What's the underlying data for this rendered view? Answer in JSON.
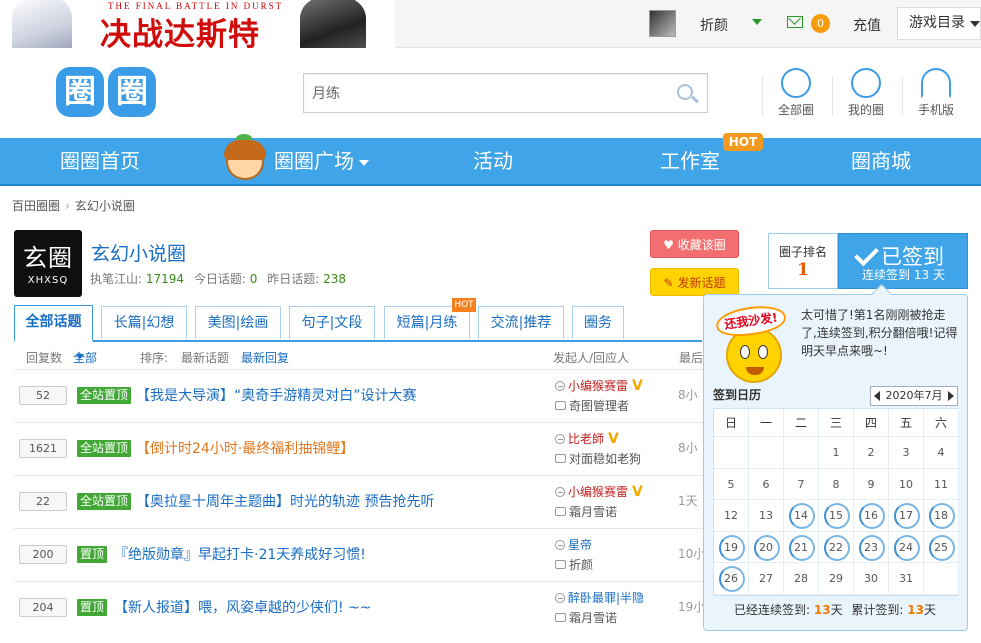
{
  "banner": {
    "subtitle": "THE FINAL BATTLE IN DURST",
    "title": "决战达斯特"
  },
  "topbar": {
    "username": "折颜",
    "mail_count": "0",
    "recharge": "充值",
    "games_menu": "游戏目录"
  },
  "header": {
    "logo": [
      "圈",
      "圈"
    ],
    "search_placeholder": "月练",
    "buttons": [
      {
        "label": "全部圈",
        "icon": "circle-refresh-icon"
      },
      {
        "label": "我的圈",
        "icon": "person-icon"
      },
      {
        "label": "手机版",
        "icon": "wifi-icon"
      }
    ]
  },
  "nav": {
    "items": [
      "圈圈首页",
      "圈圈广场",
      "活动",
      "工作室",
      "圈商城"
    ],
    "hot_tag": "HOT"
  },
  "breadcrumb": {
    "home": "百田圈圈",
    "current": "玄幻小说圈"
  },
  "group": {
    "icon_big": "玄圈",
    "icon_small": "XHXSQ",
    "name": "玄幻小说圈",
    "owner_label": "执笔江山:",
    "owner_value": "17194",
    "today_label": "今日话题:",
    "today_value": "0",
    "yesterday_label": "昨日话题:",
    "yesterday_value": "238",
    "fav_button": "收藏该圈",
    "post_button": "发新话题"
  },
  "rank": {
    "label": "圈子排名",
    "value": "1"
  },
  "signed": {
    "title": "已签到",
    "streak_label": "连续签到",
    "streak_value": "13",
    "streak_unit": "天"
  },
  "tabs": {
    "items": [
      "全部话题",
      "长篇|幻想",
      "美图|绘画",
      "句子|文段",
      "短篇|月练",
      "交流|推荐",
      "圈务"
    ],
    "hot": "HOT"
  },
  "filters": {
    "replies": "回复数",
    "all": "全部",
    "sort": "排序:",
    "latest_topic": "最新话题",
    "latest_reply": "最新回复",
    "author": "发起人/回应人",
    "last": "最后"
  },
  "topics": [
    {
      "count": "52",
      "tag": "全站置顶",
      "title": "【我是大导演】“奥奇手游精灵对白”设计大赛",
      "orange": false,
      "author": "小编猴赛雷",
      "author_vip": "V",
      "reply": "奇图管理者",
      "time": "8小"
    },
    {
      "count": "1621",
      "tag": "全站置顶",
      "title": "【倒计时24小时·最终福利抽锦鲤】",
      "orange": true,
      "author": "比老師",
      "author_vip": "V",
      "reply": "对面稳如老狗",
      "time": "8小"
    },
    {
      "count": "22",
      "tag": "全站置顶",
      "title": "【奥拉星十周年主题曲】时光的轨迹 预告抢先听",
      "orange": false,
      "author": "小编猴赛雷",
      "author_vip": "V",
      "reply": "霜月雪诺",
      "time": "1天"
    },
    {
      "count": "200",
      "tag": "置顶",
      "title": "『绝版勋章』早起打卡·21天养成好习惯!",
      "orange": false,
      "author": "星帝",
      "author_vip": "",
      "reply": "折颜",
      "time": "10小"
    },
    {
      "count": "204",
      "tag": "置顶",
      "title": "【新人报道】喂，风姿卓越的少侠们! ~~",
      "orange": false,
      "author": "醉卧最罪|半隐",
      "author_vip": "",
      "reply": "霜月雪诺",
      "time": "19小"
    }
  ],
  "popup": {
    "sticker": "还我沙发!",
    "message": "太可惜了!第1名刚刚被抢走了,连续签到,积分翻倍哦!记得明天早点来哦~!",
    "calendar_title": "签到日历",
    "month": "2020年7月",
    "weekdays": [
      "日",
      "一",
      "二",
      "三",
      "四",
      "五",
      "六"
    ],
    "days": [
      "",
      "",
      "",
      "1",
      "2",
      "3",
      "4",
      "5",
      "6",
      "7",
      "8",
      "9",
      "10",
      "11",
      "12",
      "13",
      "14",
      "15",
      "16",
      "17",
      "18",
      "19",
      "20",
      "21",
      "22",
      "23",
      "24",
      "25",
      "26",
      "27",
      "28",
      "29",
      "30",
      "31",
      ""
    ],
    "signed_days": [
      "14",
      "15",
      "16",
      "17",
      "18",
      "19",
      "20",
      "21",
      "22",
      "23",
      "24",
      "25",
      "26"
    ],
    "streak_label": "已经连续签到:",
    "streak_value": "13",
    "total_label": "累计签到:",
    "total_value": "13",
    "day_unit": "天"
  }
}
